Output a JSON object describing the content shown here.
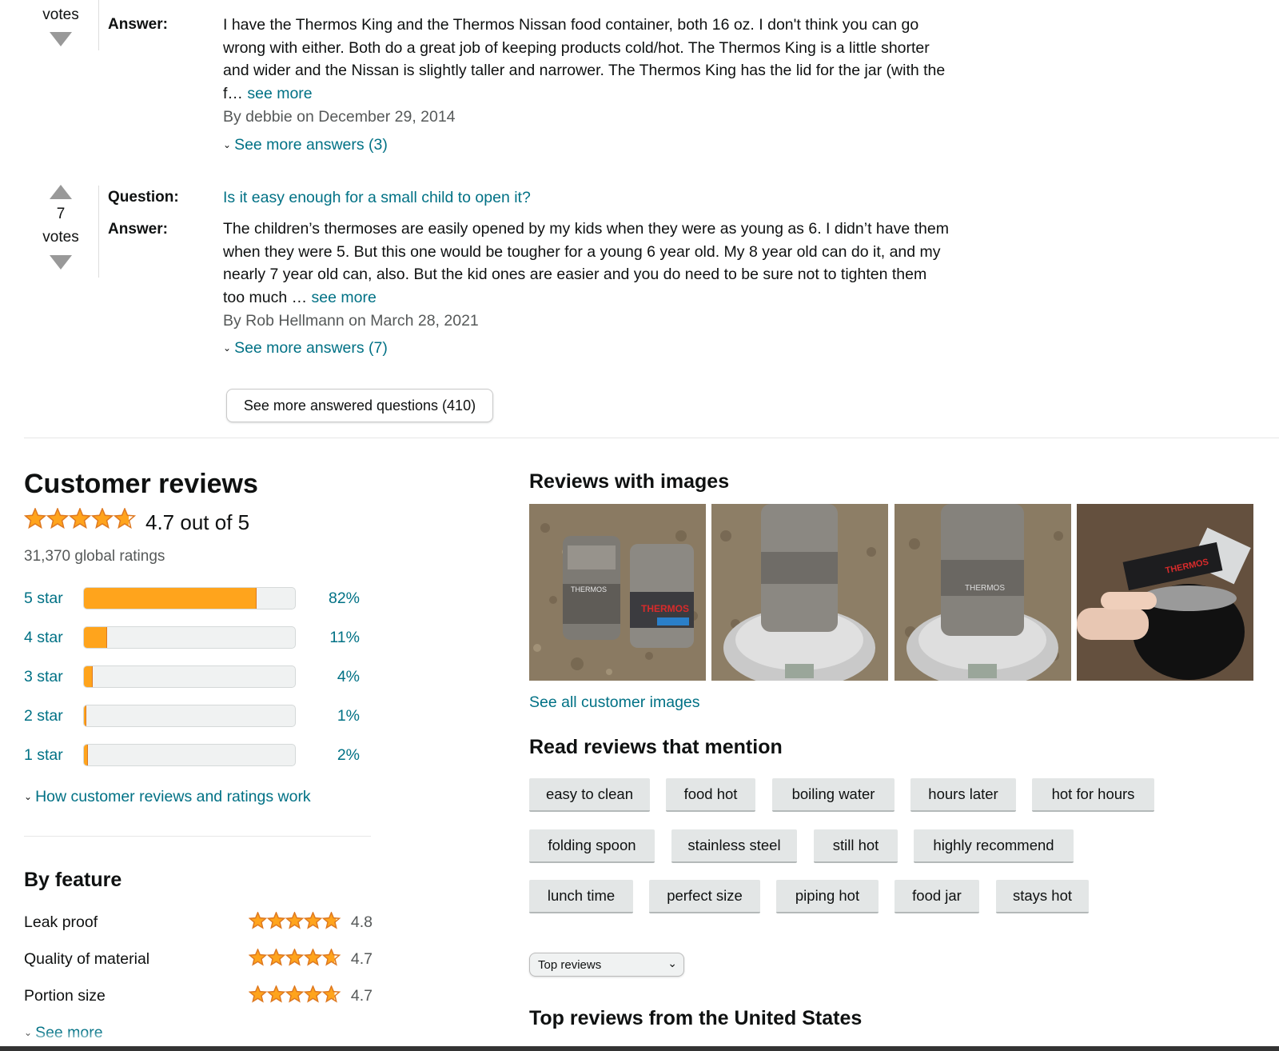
{
  "qa": [
    {
      "votes_count": "",
      "votes_label": "votes",
      "answer_label": "Answer:",
      "answer_text": "I have the Thermos King and the Thermos Nissan food container, both 16 oz. I don't think you can go wrong with either. Both do a great job of keeping products cold/hot. The Thermos King is a little shorter and wider and the Nissan is slightly taller and narrower. The Thermos King has the lid for the jar (with the f… ",
      "see_more": "see more",
      "byline": "By debbie on December 29, 2014",
      "more_answers": "See more answers (3)"
    },
    {
      "votes_count": "7",
      "votes_label": "votes",
      "question_label": "Question:",
      "question_text": "Is it easy enough for a small child to open it?",
      "answer_label": "Answer:",
      "answer_text": "The children’s thermoses are easily opened by my kids when they were as young as 6. I didn’t have them when they were 5. But this one would be tougher for a young 6 year old. My 8 year old can do it, and my nearly 7 year old can, also. But the kid ones are easier and you do need to be sure not to tighten them too much … ",
      "see_more": "see more",
      "byline": "By Rob Hellmann on March 28, 2021",
      "more_answers": "See more answers (7)"
    }
  ],
  "more_questions_button": "See more answered questions (410)",
  "reviews": {
    "title": "Customer reviews",
    "rating": 4.7,
    "rating_text": "4.7 out of 5",
    "global_ratings": "31,370 global ratings",
    "histogram": [
      {
        "label": "5 star",
        "pct_text": "82%",
        "pct": 82
      },
      {
        "label": "4 star",
        "pct_text": "11%",
        "pct": 11
      },
      {
        "label": "3 star",
        "pct_text": "4%",
        "pct": 4
      },
      {
        "label": "2 star",
        "pct_text": "1%",
        "pct": 1
      },
      {
        "label": "1 star",
        "pct_text": "2%",
        "pct": 2
      }
    ],
    "how_link": "How customer reviews and ratings work",
    "feature_title": "By feature",
    "features": [
      {
        "name": "Leak proof",
        "rating": 4.8,
        "value": "4.8"
      },
      {
        "name": "Quality of material",
        "rating": 4.7,
        "value": "4.7"
      },
      {
        "name": "Portion size",
        "rating": 4.7,
        "value": "4.7"
      }
    ],
    "see_more": "See more"
  },
  "images": {
    "title": "Reviews with images",
    "see_all": "See all customer images",
    "thumbs": [
      {
        "name": "review-image-two-thermos-jars"
      },
      {
        "name": "review-image-jar-on-scale-1"
      },
      {
        "name": "review-image-jar-on-scale-2"
      },
      {
        "name": "review-image-black-jar-in-hand"
      }
    ]
  },
  "mentions": {
    "title": "Read reviews that mention",
    "chips": [
      [
        "easy to clean",
        "food hot",
        "boiling water",
        "hours later",
        "hot for hours"
      ],
      [
        "folding spoon",
        "stainless steel",
        "still hot",
        "highly recommend"
      ],
      [
        "lunch time",
        "perfect size",
        "piping hot",
        "food jar",
        "stays hot"
      ]
    ]
  },
  "sort": {
    "selected": "Top reviews"
  },
  "top_reviews_title": "Top reviews from the United States",
  "colors": {
    "link": "#007185",
    "star": "#FFA41C",
    "star_border": "#de7921",
    "chip_bg": "#E3E6E6"
  },
  "icons": {
    "upvote": "triangle-up-icon",
    "downvote": "triangle-down-icon",
    "chevron": "chevron-down-icon",
    "star": "star-icon"
  }
}
